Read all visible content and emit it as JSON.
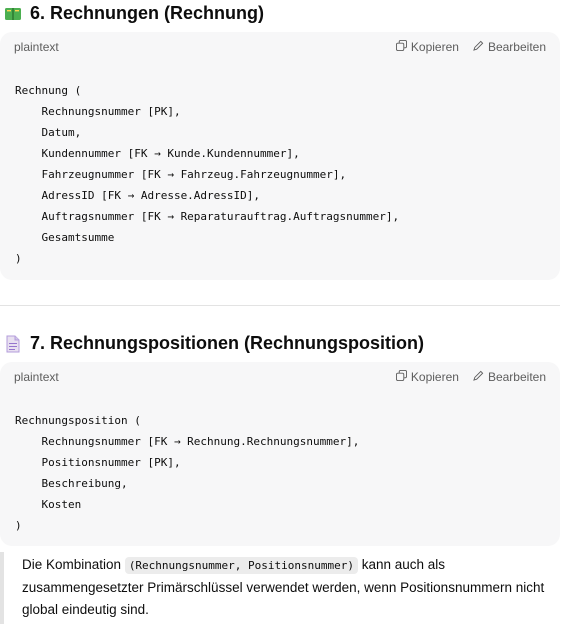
{
  "sections": [
    {
      "heading": "6. Rechnungen (Rechnung)",
      "heading_icon": "green-book-icon",
      "code": {
        "language": "plaintext",
        "copy_label": "Kopieren",
        "edit_label": "Bearbeiten",
        "lines": [
          "Rechnung (",
          "    Rechnungsnummer [PK],",
          "    Datum,",
          "    Kundennummer [FK → Kunde.Kundennummer],",
          "    Fahrzeugnummer [FK → Fahrzeug.Fahrzeugnummer],",
          "    AdressID [FK → Adresse.AdressID],",
          "    Auftragsnummer [FK → Reparaturauftrag.Auftragsnummer],",
          "    Gesamtsumme",
          ")"
        ]
      }
    },
    {
      "heading": "7. Rechnungspositionen (Rechnungsposition)",
      "heading_icon": "page-document-icon",
      "code": {
        "language": "plaintext",
        "copy_label": "Kopieren",
        "edit_label": "Bearbeiten",
        "lines": [
          "Rechnungsposition (",
          "    Rechnungsnummer [FK → Rechnung.Rechnungsnummer],",
          "    Positionsnummer [PK],",
          "    Beschreibung,",
          "    Kosten",
          ")"
        ]
      }
    }
  ],
  "note": {
    "before": "Die Kombination ",
    "code": "(Rechnungsnummer, Positionsnummer)",
    "after": " kann auch als zusammengesetzter Primärschlüssel verwendet werden, wenn Positionsnummern nicht global eindeutig sind."
  }
}
